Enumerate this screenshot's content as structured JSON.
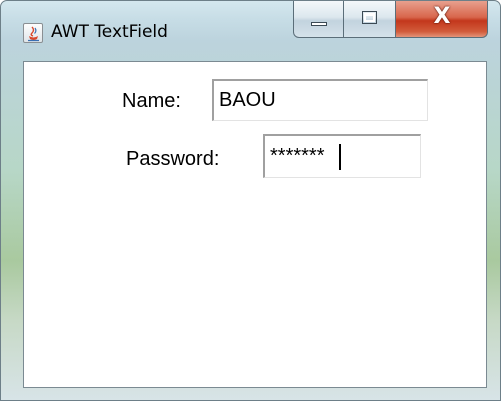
{
  "window": {
    "title": "AWT TextField",
    "app_icon": "java-cup-icon",
    "caption_buttons": {
      "minimize_icon": "minimize-icon",
      "maximize_icon": "maximize-icon",
      "close_glyph": "X"
    }
  },
  "form": {
    "name_label": "Name:",
    "name_value": "BAOU",
    "password_label": "Password:",
    "password_display": "*******"
  },
  "colors": {
    "close_button": "#c3371c",
    "frame": "#bcd3dd"
  }
}
